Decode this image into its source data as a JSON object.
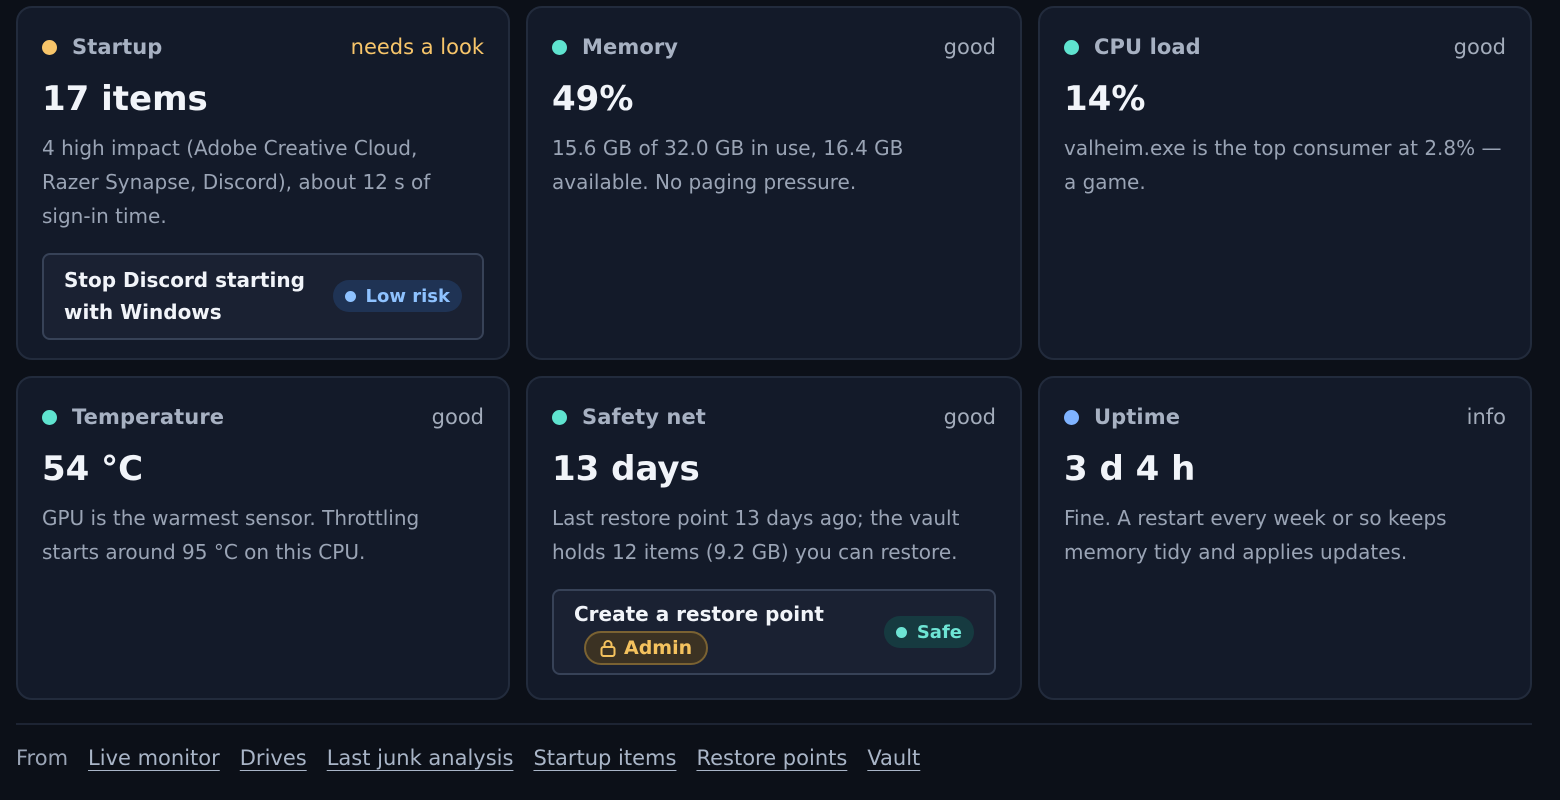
{
  "colors": {
    "warn": "#f7c56a",
    "good": "#5fe3cf",
    "info": "#7fb3ff"
  },
  "cards": [
    {
      "title": "Startup",
      "status": "needs a look",
      "dot_color": "#f7c56a",
      "value": "17 items",
      "description": "4 high impact (Adobe Creative Cloud, Razer Synapse, Discord), about 12 s of sign-in time.",
      "action": {
        "label": "Stop Discord starting with Windows",
        "badge": "Low risk"
      }
    },
    {
      "title": "Memory",
      "status": "good",
      "dot_color": "#5fe3cf",
      "value": "49%",
      "description": "15.6 GB of 32.0 GB in use, 16.4 GB available. No paging pressure."
    },
    {
      "title": "CPU load",
      "status": "good",
      "dot_color": "#5fe3cf",
      "value": "14%",
      "description": "valheim.exe is the top consumer at 2.8% — a game."
    },
    {
      "title": "Temperature",
      "status": "good",
      "dot_color": "#5fe3cf",
      "value": "54 °C",
      "description": "GPU is the warmest sensor. Throttling starts around 95 °C on this CPU."
    },
    {
      "title": "Safety net",
      "status": "good",
      "dot_color": "#5fe3cf",
      "value": "13 days",
      "description": "Last restore point 13 days ago; the vault holds 12 items (9.2 GB) you can restore.",
      "action": {
        "label": "Create a restore point",
        "admin": "Admin",
        "badge": "Safe"
      }
    },
    {
      "title": "Uptime",
      "status": "info",
      "dot_color": "#7fb3ff",
      "value": "3 d 4 h",
      "description": "Fine. A restart every week or so keeps memory tidy and applies updates."
    }
  ],
  "footer": {
    "from_label": "From",
    "links": [
      "Live monitor",
      "Drives",
      "Last junk analysis",
      "Startup items",
      "Restore points",
      "Vault"
    ]
  },
  "icons": {
    "admin": "lock-icon"
  }
}
